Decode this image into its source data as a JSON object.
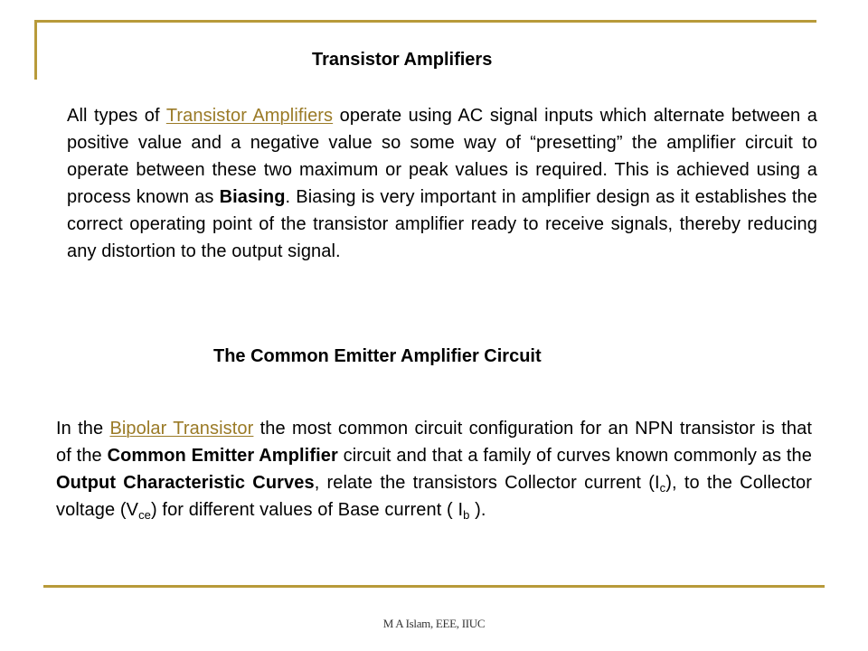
{
  "slide": {
    "title": "Transistor Amplifiers",
    "accent_color": "#b89a3a",
    "link_color": "#9a7a26"
  },
  "section1": {
    "paragraph": {
      "t1": "All types of ",
      "link": "Transistor Amplifiers",
      "t2": " operate using AC signal inputs which alternate between a positive value and a negative value so some way of “presetting” the amplifier circuit to operate between these two maximum or peak values is required. This is achieved using a process known as ",
      "bold1": "Biasing",
      "t3": ". Biasing is very important in amplifier design as it establishes the correct operating point of the transistor amplifier ready to receive signals, thereby reducing any distortion to the output signal."
    }
  },
  "section2": {
    "heading": "The Common Emitter Amplifier Circuit",
    "paragraph": {
      "t1": "In the ",
      "link": "Bipolar Transistor",
      "t2": " the most common circuit configuration for an NPN transistor is that of the ",
      "bold1": "Common Emitter Amplifier",
      "t3": " circuit and that a family of curves known commonly as the ",
      "bold2": "Output Characteristic Curves",
      "t4": ", relate the transistors Collector current (I",
      "sub1": "c",
      "t5": "), to the Collector voltage (V",
      "sub2": "ce",
      "t6": ") for different values of Base current ( I",
      "sub3": "b",
      "t7": " )."
    }
  },
  "footer": {
    "text": "M A Islam, EEE, IIUC"
  }
}
